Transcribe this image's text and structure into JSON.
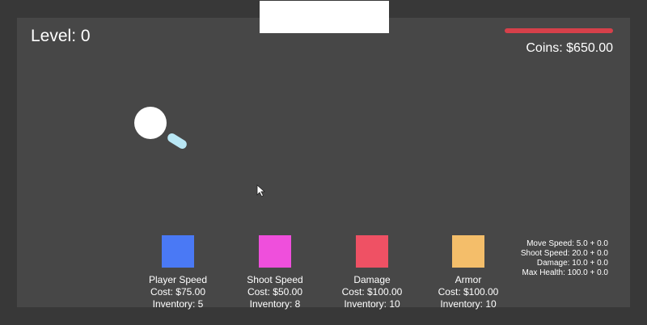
{
  "hud": {
    "level_text": "Level: 0",
    "coins_text": "Coins: $650.00",
    "health_bar_color": "#d6404a",
    "health_fraction": 1.0
  },
  "shop": {
    "items": [
      {
        "name": "Player Speed",
        "cost": "Cost: $75.00",
        "inventory": "Inventory: 5",
        "color": "#4a79f5"
      },
      {
        "name": "Shoot Speed",
        "cost": "Cost: $50.00",
        "inventory": "Inventory: 8",
        "color": "#ef4fdc"
      },
      {
        "name": "Damage",
        "cost": "Cost: $100.00",
        "inventory": "Inventory: 10",
        "color": "#ef5164"
      },
      {
        "name": "Armor",
        "cost": "Cost: $100.00",
        "inventory": "Inventory: 10",
        "color": "#f4be6a"
      }
    ]
  },
  "stats": {
    "move_speed": "Move Speed: 5.0 + 0.0",
    "shoot_speed": "Shoot Speed: 20.0 + 0.0",
    "damage": "Damage: 10.0 + 0.0",
    "max_health": "Max Health: 100.0 + 0.0"
  },
  "colors": {
    "background": "#383838",
    "arena": "#474747",
    "player": "#ffffff",
    "bullet": "#b9e7f5"
  },
  "icons": {
    "cursor": "mouse-cursor-icon"
  }
}
